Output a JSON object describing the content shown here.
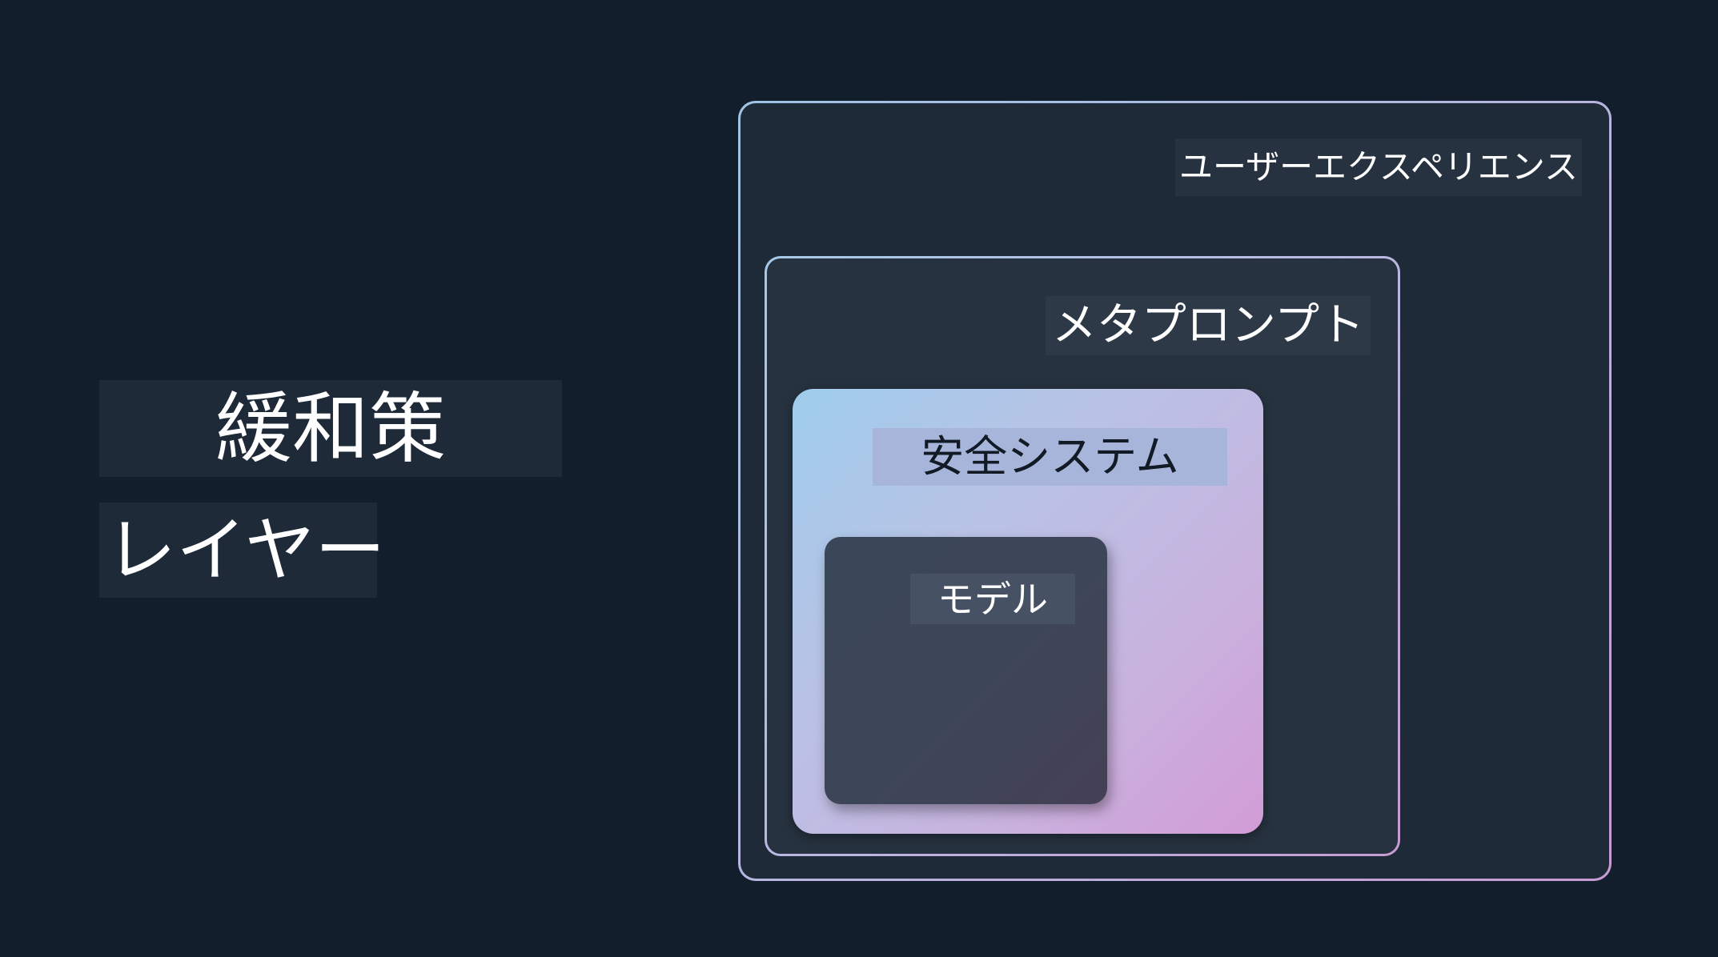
{
  "title": {
    "line1": "緩和策",
    "line2": "レイヤー"
  },
  "layers": {
    "outer": {
      "label": "ユーザーエクスペリエンス"
    },
    "second": {
      "label": "メタプロンプト"
    },
    "third": {
      "label": "安全システム"
    },
    "core": {
      "label": "モデル"
    }
  },
  "colors": {
    "background": "#121e2b",
    "layer_fill": "#1e2a37",
    "border_start": "#9fc3e4",
    "border_end": "#c79bd2",
    "safety_gradient_start": "#9fcdec",
    "safety_gradient_end": "#d29cd6",
    "model_fill": "#3a4758",
    "text": "#ffffff"
  }
}
